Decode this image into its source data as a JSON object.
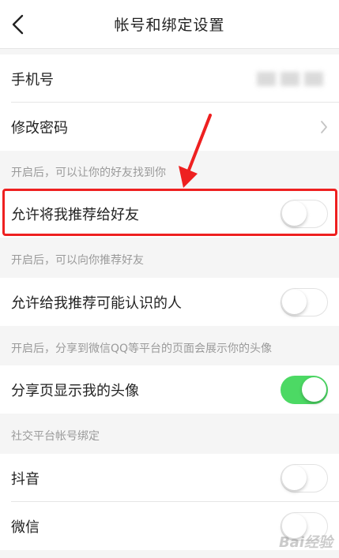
{
  "nav": {
    "title": "帐号和绑定设置",
    "back_icon": "chevron-left-icon"
  },
  "rows": {
    "phone": {
      "label": "手机号"
    },
    "password": {
      "label": "修改密码",
      "chevron_icon": "chevron-right-icon"
    },
    "recommend_me": {
      "label": "允许将我推荐给好友",
      "enabled": false
    },
    "recommend_to_me": {
      "label": "允许给我推荐可能认识的人",
      "enabled": false
    },
    "share_avatar": {
      "label": "分享页显示我的头像",
      "enabled": true
    },
    "douyin": {
      "label": "抖音",
      "enabled": false
    },
    "wechat": {
      "label": "微信",
      "enabled": false
    }
  },
  "notes": {
    "find_me": "开启后，可以让你的好友找到你",
    "recommend": "开启后，可以向你推荐好友",
    "share": "开启后，分享到微信QQ等平台的页面会展示你的头像",
    "social": "社交平台帐号绑定"
  },
  "watermark": "Bai经验",
  "colors": {
    "toggle_on": "#4cd964",
    "highlight": "#ee2020"
  }
}
